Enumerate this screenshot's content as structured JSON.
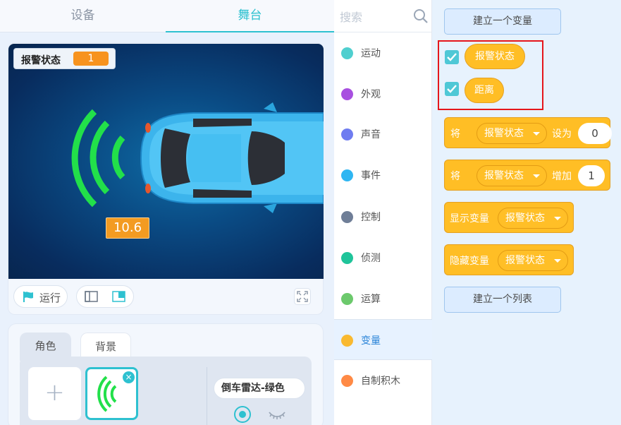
{
  "top_tabs": {
    "device": "设备",
    "stage": "舞台"
  },
  "stage": {
    "monitor_label": "报警状态",
    "monitor_value": "1",
    "distance_label": "10.6"
  },
  "controls": {
    "run_label": "运行"
  },
  "sprite_panel": {
    "tab_sprite": "角色",
    "tab_backdrop": "背景",
    "add_label": "+",
    "delete_label": "×",
    "sprite_name": "倒车雷达-绿色"
  },
  "search": {
    "placeholder": "搜索"
  },
  "categories": [
    {
      "label": "运动",
      "color": "#4fcfcf"
    },
    {
      "label": "外观",
      "color": "#a84fe0"
    },
    {
      "label": "声音",
      "color": "#6f7cf0"
    },
    {
      "label": "事件",
      "color": "#2fb6f2"
    },
    {
      "label": "控制",
      "color": "#6f7e97"
    },
    {
      "label": "侦测",
      "color": "#1fc49a"
    },
    {
      "label": "运算",
      "color": "#6cc96c"
    },
    {
      "label": "变量",
      "color": "#f9b930"
    },
    {
      "label": "自制积木",
      "color": "#ff8a45"
    }
  ],
  "palette": {
    "make_variable": "建立一个变量",
    "make_list": "建立一个列表",
    "variables": [
      "报警状态",
      "距离"
    ],
    "set_block": {
      "prefix": "将",
      "var": "报警状态",
      "verb": "设为",
      "value": "0"
    },
    "change_block": {
      "prefix": "将",
      "var": "报警状态",
      "verb": "增加",
      "value": "1"
    },
    "show_block": {
      "prefix": "显示变量",
      "var": "报警状态"
    },
    "hide_block": {
      "prefix": "隐藏变量",
      "var": "报警状态"
    }
  },
  "colors": {
    "accent": "#2ec1d0",
    "variable_block": "#ffbe25",
    "highlight": "#e5161b",
    "sensor_wave": "#22e04a"
  }
}
